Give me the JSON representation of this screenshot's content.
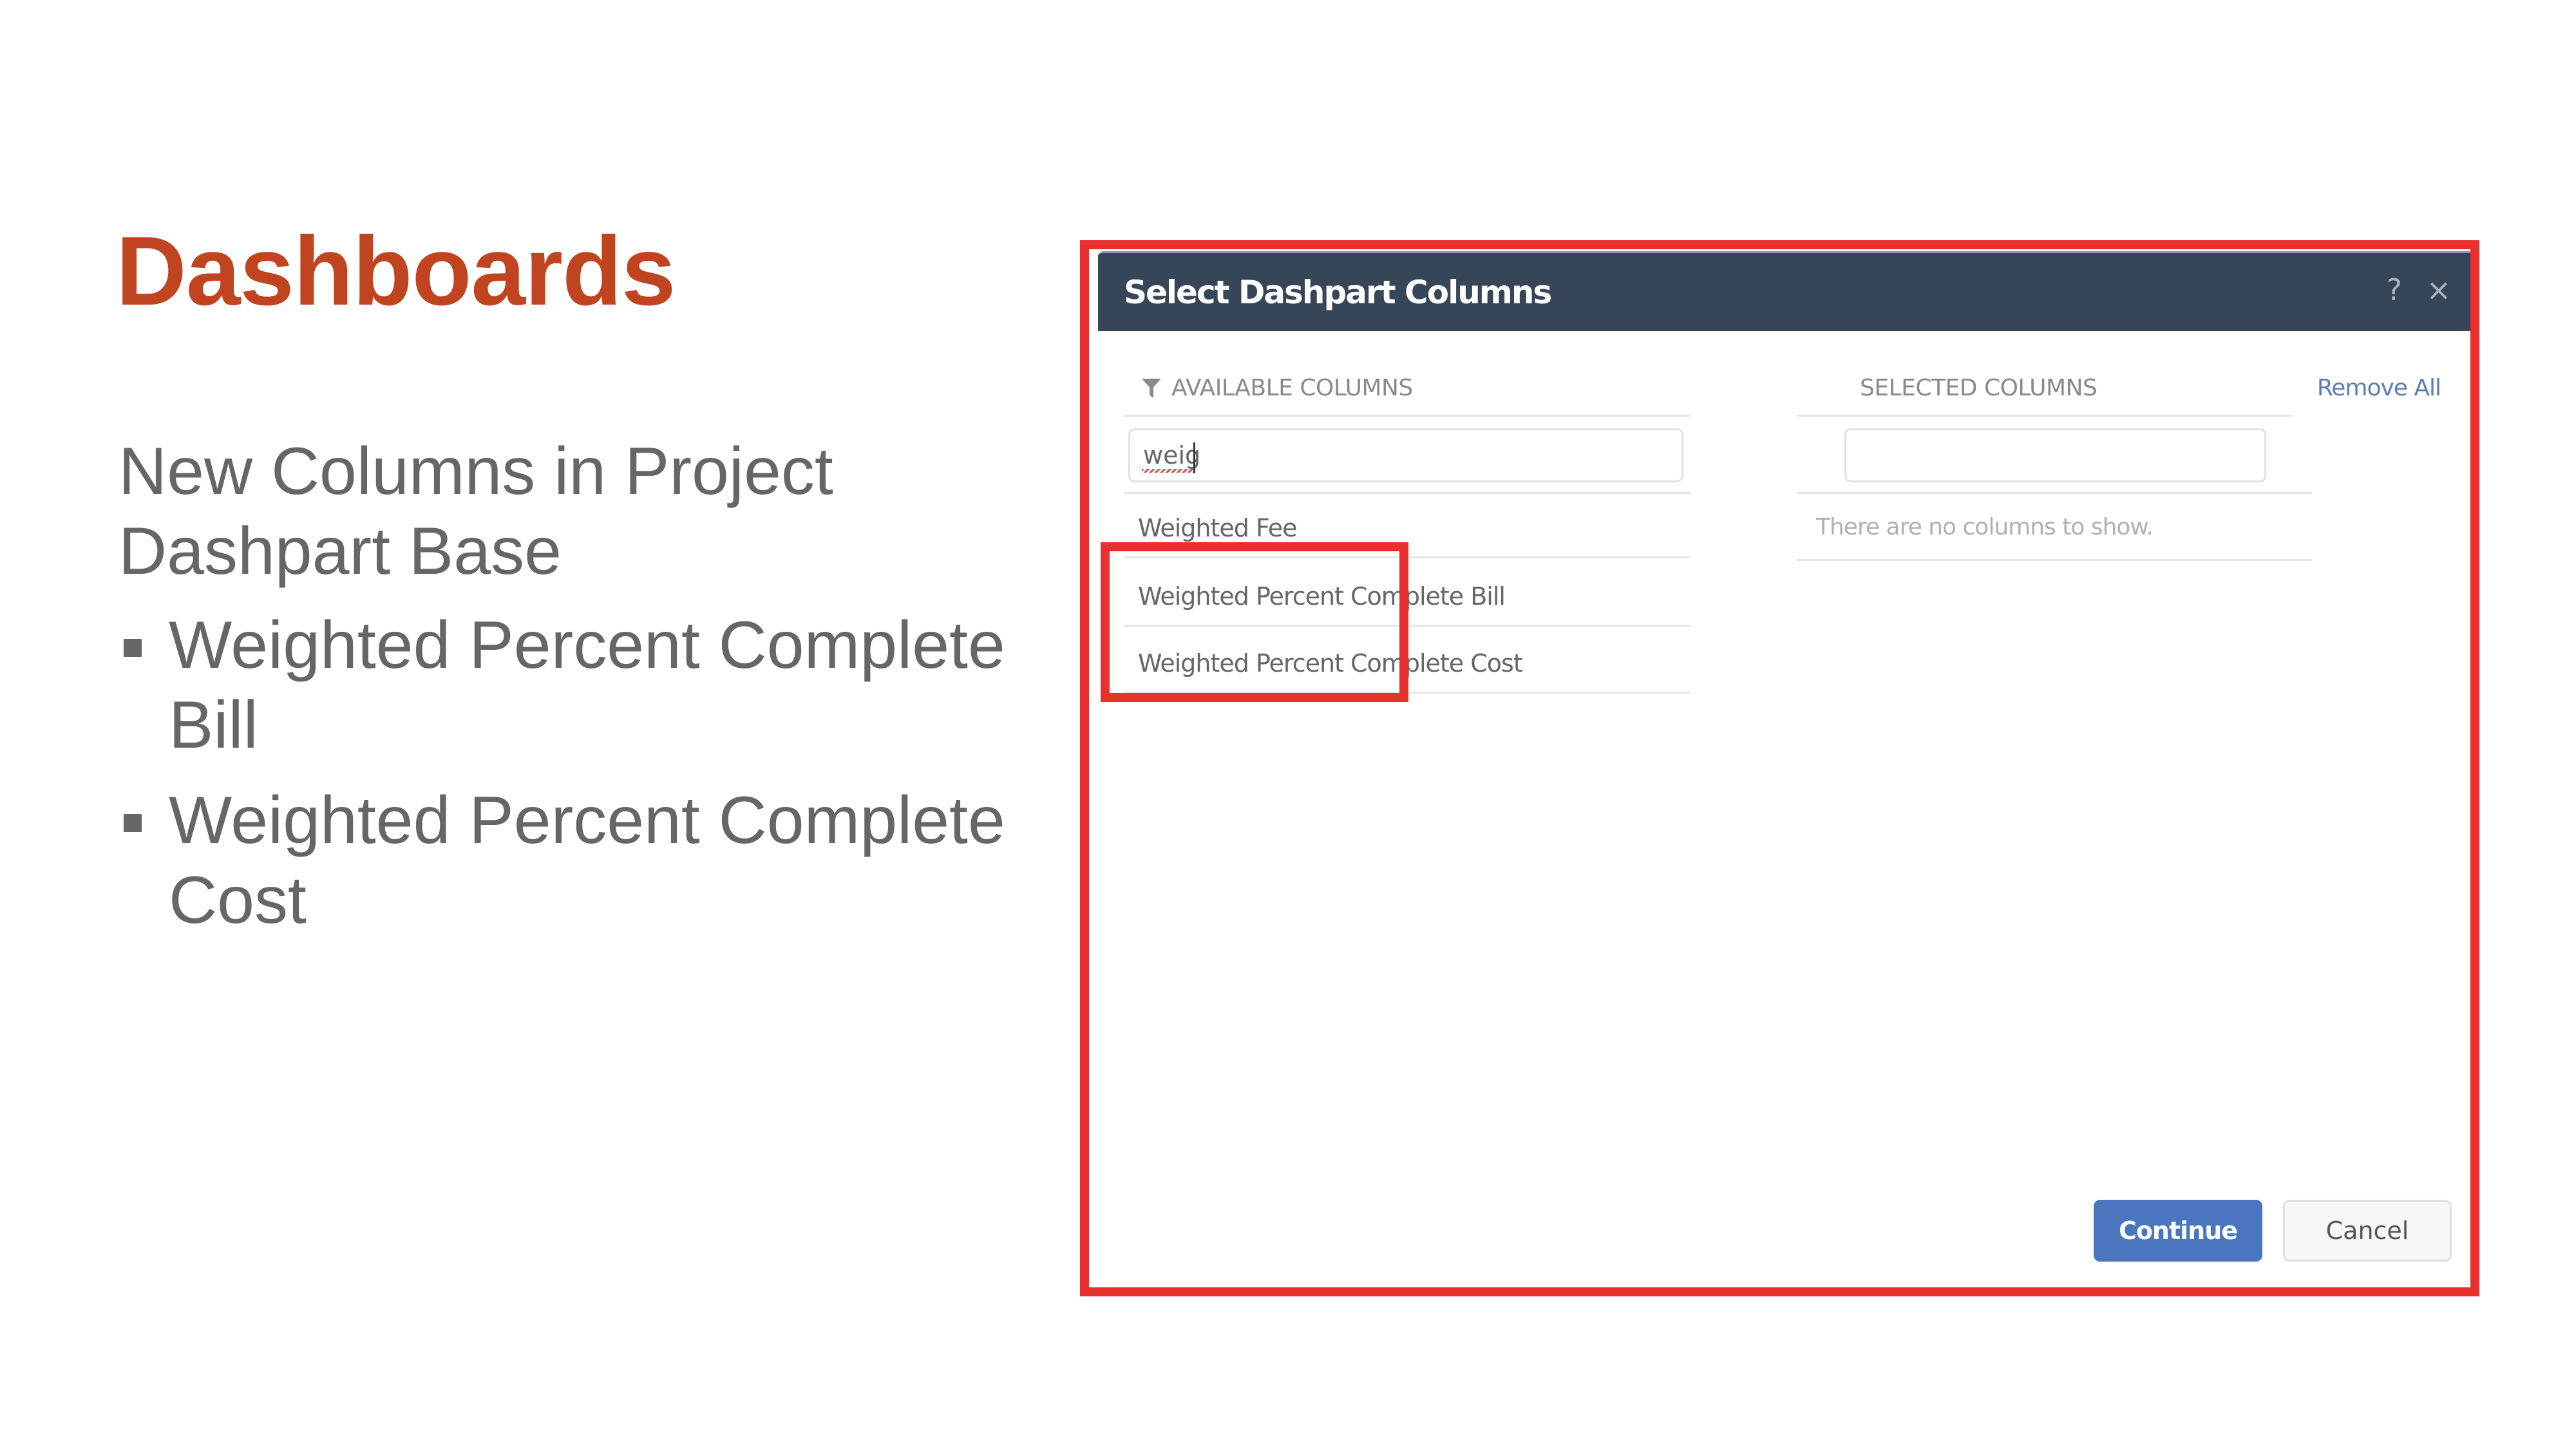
{
  "slide": {
    "title": "Dashboards",
    "subtitle": "New Columns in Project Dashpart Base",
    "bullets": [
      "Weighted Percent Complete Bill",
      "Weighted Percent Complete Cost"
    ]
  },
  "dialog": {
    "title": "Select Dashpart Columns",
    "help_icon": "?",
    "close_icon": "×",
    "available": {
      "header": "AVAILABLE COLUMNS",
      "filter_icon": "filter-icon",
      "search_value": "weig",
      "items": [
        "Weighted Fee",
        "Weighted Percent Complete Bill",
        "Weighted Percent Complete Cost"
      ]
    },
    "selected": {
      "header": "SELECTED COLUMNS",
      "remove_all": "Remove All",
      "search_value": "",
      "empty_message": "There are no columns to show."
    },
    "buttons": {
      "continue": "Continue",
      "cancel": "Cancel"
    }
  },
  "colors": {
    "title": "#c0441f",
    "highlight": "#e8302f",
    "dialog_header": "#374558",
    "primary_button": "#4a76bf",
    "link": "#5a7fb5"
  }
}
